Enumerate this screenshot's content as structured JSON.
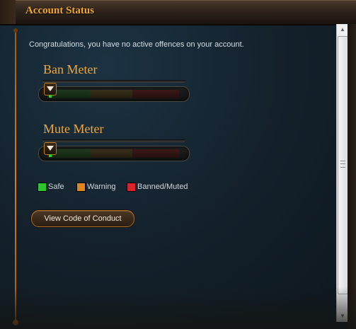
{
  "window": {
    "title": "Account Status"
  },
  "message": "Congratulations, you have no active offences on your account.",
  "meters": [
    {
      "title": "Ban Meter",
      "level": 0
    },
    {
      "title": "Mute Meter",
      "level": 0
    }
  ],
  "legend": [
    {
      "label": "Safe",
      "color": "#2fc42f"
    },
    {
      "label": "Warning",
      "color": "#e0861c"
    },
    {
      "label": "Banned/Muted",
      "color": "#d8242a"
    }
  ],
  "button": {
    "label": "View Code of Conduct"
  },
  "colors": {
    "accent": "#f0a63a",
    "title": "#f0a92a",
    "background": "#14222d"
  }
}
